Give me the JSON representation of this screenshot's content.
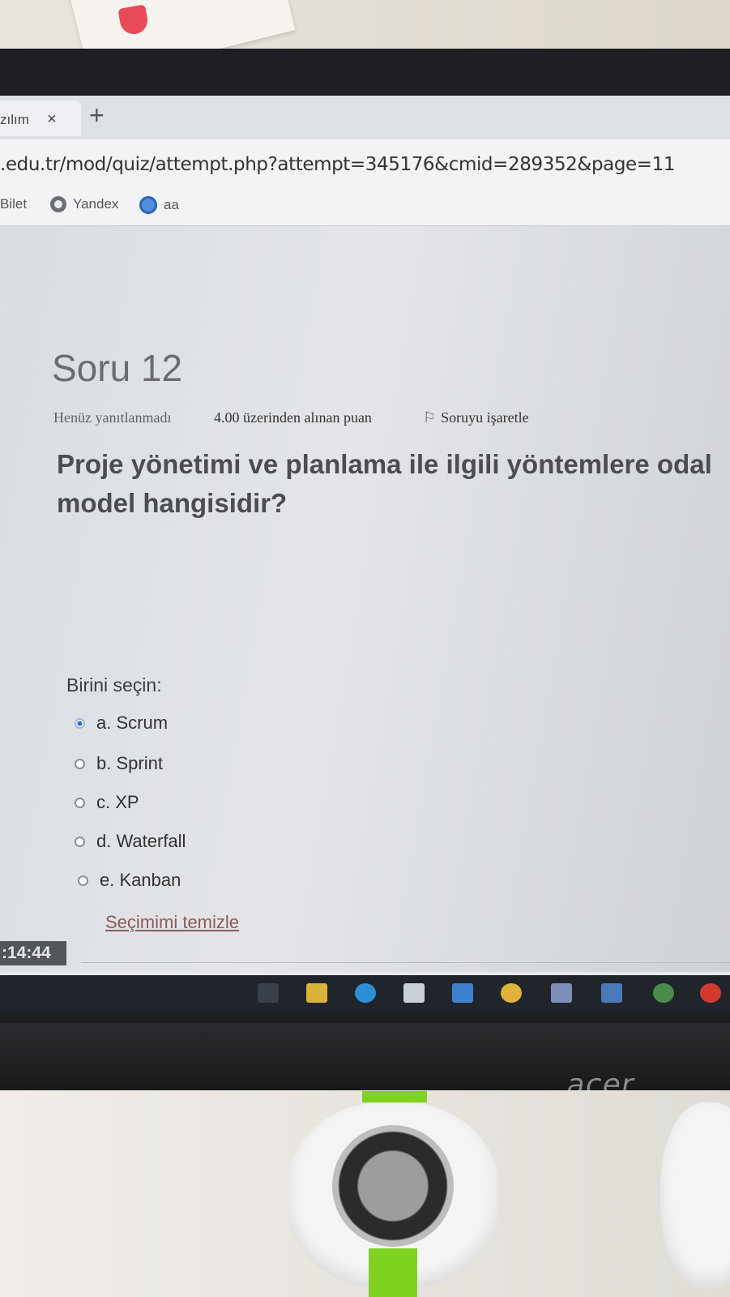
{
  "browser": {
    "tab_label": "zılım",
    "tab_close": "×",
    "new_tab": "+",
    "url": ".edu.tr/mod/quiz/attempt.php?attempt=345176&cmid=289352&page=11",
    "bookmarks": [
      "Bilet",
      "Yandex",
      "aa"
    ]
  },
  "quiz": {
    "title": "Soru 12",
    "status": "Henüz yanıtlanmadı",
    "points": "4.00 üzerinden alınan puan",
    "flag_label": "Soruyu işaretle",
    "question_line1": "Proje yönetimi ve planlama ile ilgili yöntemlere odal",
    "question_line2": "model hangisidir?",
    "choose_label": "Birini seçin:",
    "options": [
      {
        "label": "a. Scrum",
        "selected": true
      },
      {
        "label": "b. Sprint",
        "selected": false
      },
      {
        "label": "c. XP",
        "selected": false
      },
      {
        "label": "d. Waterfall",
        "selected": false
      },
      {
        "label": "e. Kanban",
        "selected": false
      }
    ],
    "clear_choice": "Seçimimi temizle",
    "timer": ":14:44"
  },
  "monitor": {
    "brand": "acer"
  },
  "colors": {
    "accent": "#2f6fd0",
    "link": "#8e5a5a"
  }
}
